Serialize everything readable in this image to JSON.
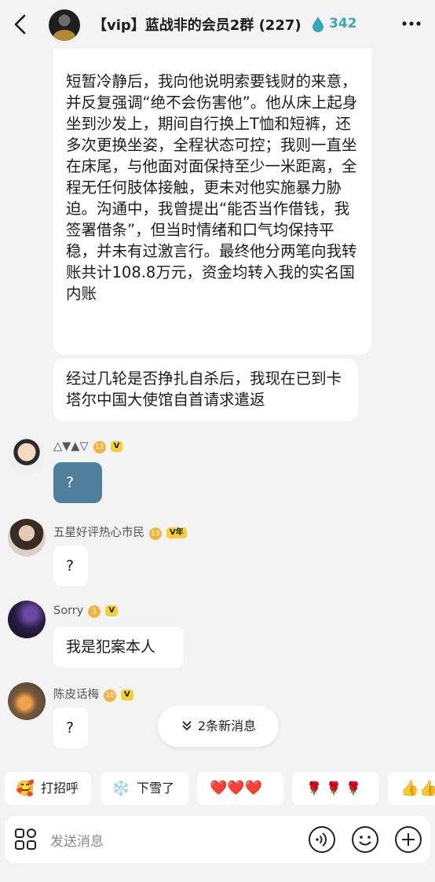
{
  "header": {
    "title": "【vip】蓝战非的会员2群 (227)",
    "fire_count": "342"
  },
  "messages": {
    "long_text": "短暂冷静后，我向他说明索要钱财的来意，并反复强调“绝不会伤害他”。他从床上起身坐到沙发上，期间自行换上T恤和短裤，还多次更换坐姿，全程状态可控；我则一直坐在床尾，与他面对面保持至少一米距离，全程无任何肢体接触，更未对他实施暴力胁迫。沟通中，我曾提出“能否当作借钱，我签署借条”，但当时情绪和口气均保持平稳，并未有过激言行。最终他分两笔向我转账共计108.8万元，资金均转入我的实名国内账",
    "short_text": "经过几轮是否挣扎自杀后，我现在已到卡塔尔中国大使馆自首请求遣返",
    "users": [
      {
        "name": "△▼▲▽",
        "level": "12",
        "badge": "V",
        "text": "?"
      },
      {
        "name": "五星好评热心市民",
        "level": "13",
        "badge": "V年",
        "text": "?"
      },
      {
        "name": "Sorry",
        "level": "1",
        "badge": "V",
        "text": "我是犯案本人"
      },
      {
        "name": "陈皮话梅",
        "level": "10",
        "badge": "V",
        "text": "?"
      }
    ]
  },
  "new_messages": "2条新消息",
  "chips": [
    {
      "icon": "🥰",
      "label": "打招呼"
    },
    {
      "icon": "❄️",
      "label": "下雪了"
    },
    {
      "icon": "❤️❤️❤️",
      "label": ""
    },
    {
      "icon": "🌹 🌹 🌹",
      "label": ""
    },
    {
      "icon": "👍👍",
      "label": ""
    }
  ],
  "input": {
    "placeholder": "发送消息"
  },
  "colors": {
    "accent_teal": "#3aa7b7",
    "blue_bubble": "#4f7f9a",
    "badge_yellow": "#f5cf34"
  }
}
